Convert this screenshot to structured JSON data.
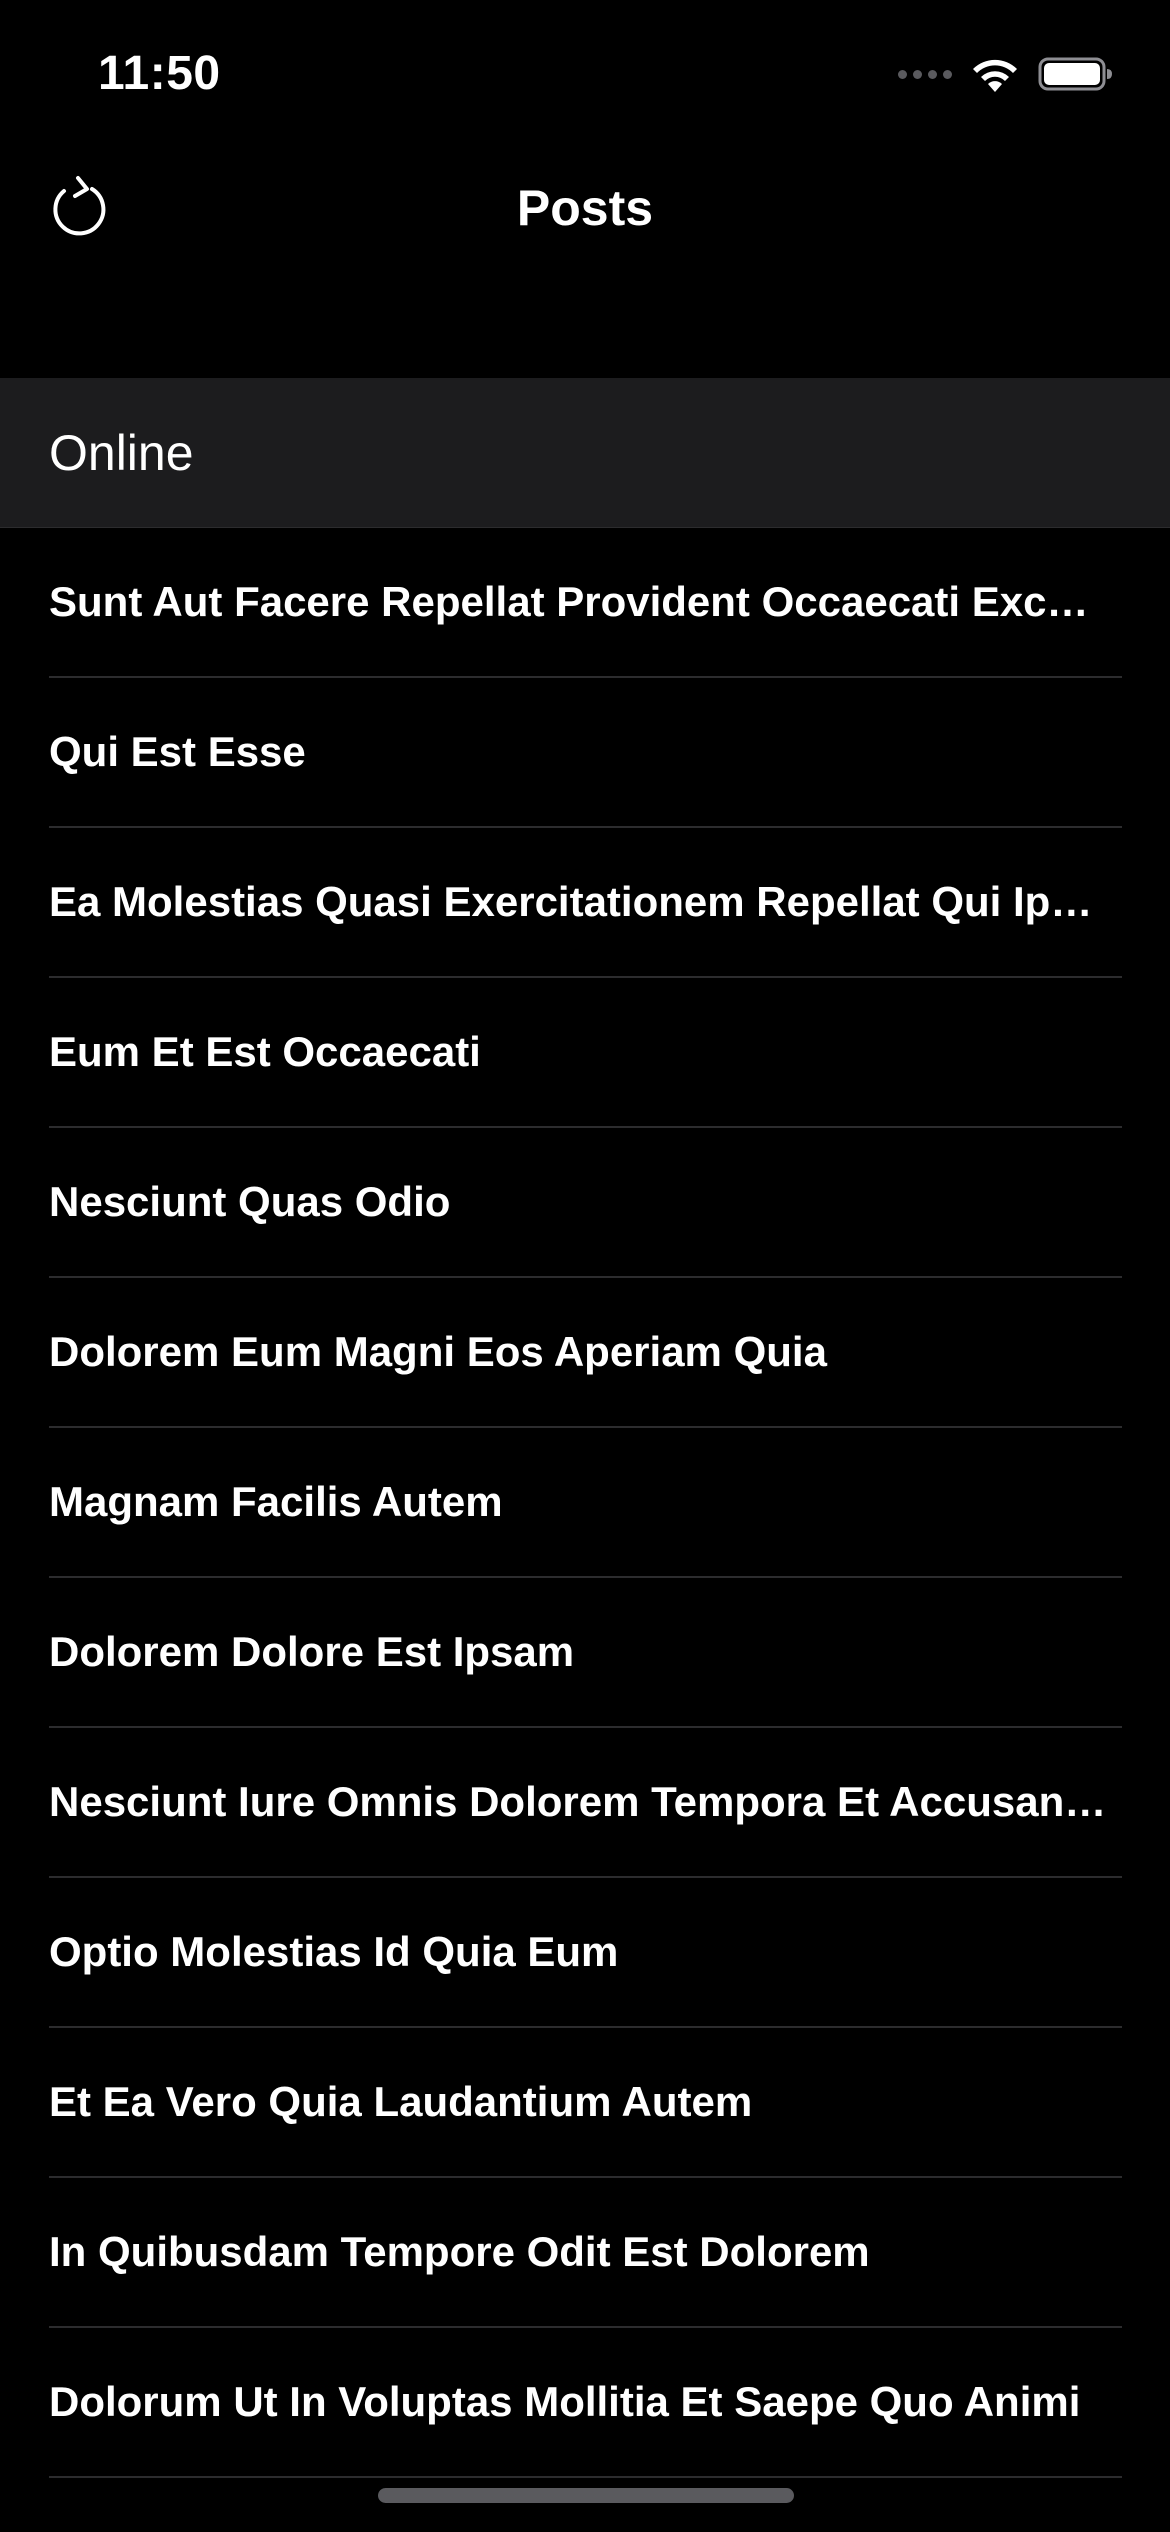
{
  "status_bar": {
    "time": "11:50",
    "icons": [
      "signal-icon",
      "wifi-icon",
      "battery-icon"
    ]
  },
  "nav": {
    "title": "Posts",
    "left_icon": "refresh-icon"
  },
  "section": {
    "header": "Online"
  },
  "posts": [
    "Sunt Aut Facere Repellat Provident Occaecati Excepturi Optio Reprehenderit",
    "Qui Est Esse",
    "Ea Molestias Quasi Exercitationem Repellat Qui Ipsa Sit Aut",
    "Eum Et Est Occaecati",
    "Nesciunt Quas Odio",
    "Dolorem Eum Magni Eos Aperiam Quia",
    "Magnam Facilis Autem",
    "Dolorem Dolore Est Ipsam",
    "Nesciunt Iure Omnis Dolorem Tempora Et Accusantium",
    "Optio Molestias Id Quia Eum",
    "Et Ea Vero Quia Laudantium Autem",
    "In Quibusdam Tempore Odit Est Dolorem",
    "Dolorum Ut In Voluptas Mollitia Et Saepe Quo Animi"
  ],
  "colors": {
    "background": "#000000",
    "section_background": "#1c1c1e",
    "separator": "#2c2c2e",
    "text": "#ffffff"
  }
}
